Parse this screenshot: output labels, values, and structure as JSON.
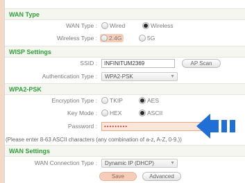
{
  "wan_type": {
    "header": "WAN Type",
    "wan_type_label": "WAN Type",
    "wired": "Wired",
    "wireless": "Wireless",
    "wireless_type_label": "Wireless Type",
    "band_24": "2.4G",
    "band_5": "5G"
  },
  "wisp": {
    "header": "WISP Settings",
    "ssid_label": "SSID",
    "ssid_value": "INFINITUM2369",
    "ap_scan": "AP Scan",
    "auth_label": "Authentication Type",
    "auth_value": "WPA2-PSK"
  },
  "wpa2": {
    "header": "WPA2-PSK",
    "enc_label": "Encryption Type",
    "tkip": "TKIP",
    "aes": "AES",
    "key_mode_label": "Key Mode",
    "hex": "HEX",
    "ascii": "ASCII",
    "password_label": "Password",
    "password_value": "•••••••••",
    "hint": "(Please enter 8-63 ASCII characters (any combination of a-z, A-Z, 0-9.))"
  },
  "wan_settings": {
    "header": "WAN Settings",
    "conn_label": "WAN Connection Type",
    "conn_value": "Dynamic IP (DHCP)"
  },
  "actions": {
    "save": "Save",
    "advanced": "Advanced"
  },
  "colors": {
    "accent": "#2f9e3a",
    "highlight": "#f6cdb8",
    "arrow": "#1f6fd6"
  },
  "icons": [
    "select-arrow-icon",
    "blue-arrow-icon"
  ]
}
